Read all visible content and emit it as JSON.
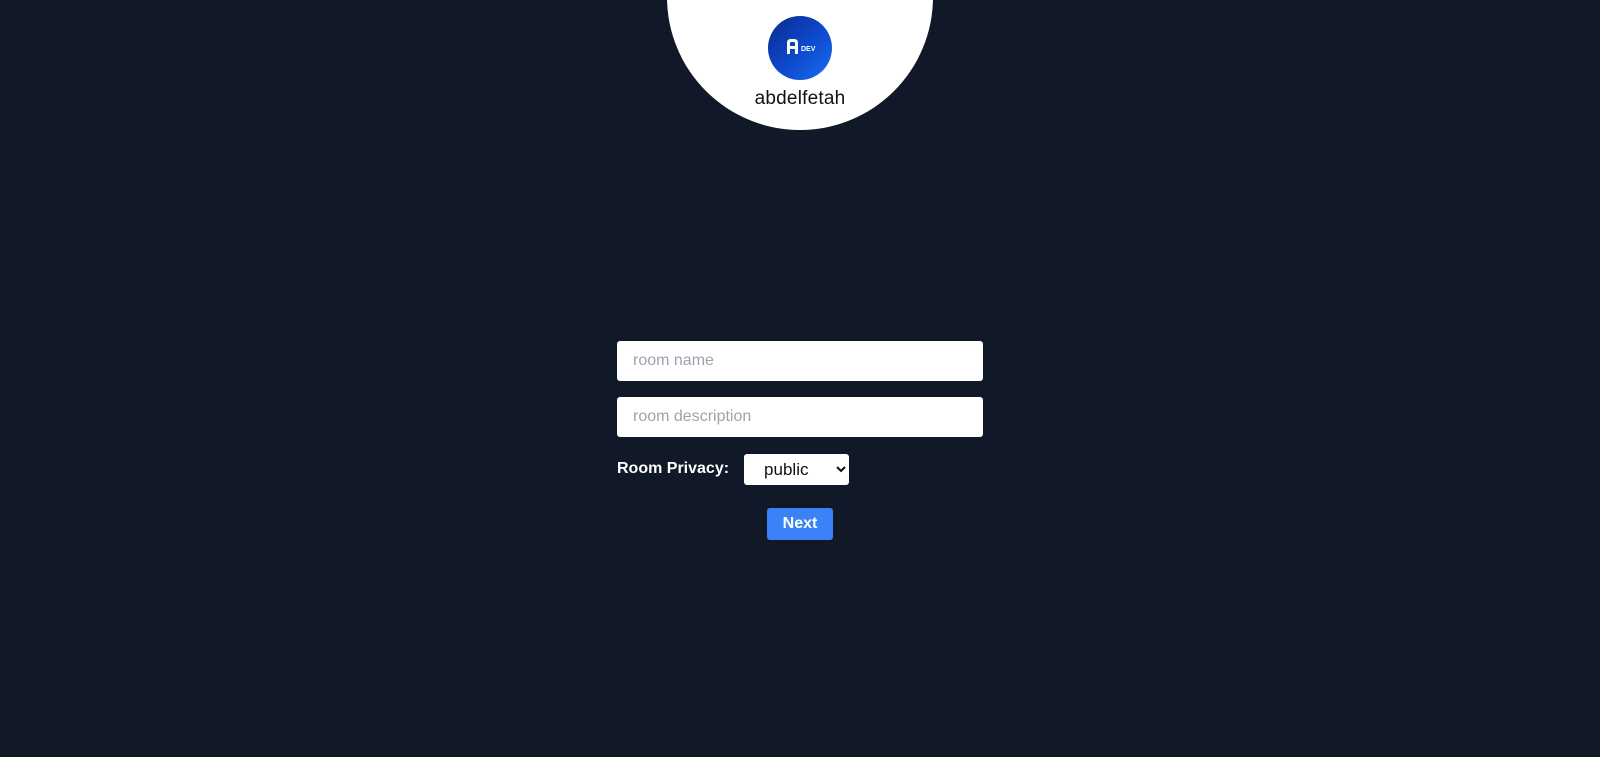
{
  "profile": {
    "username": "abdelfetah",
    "avatar_logo_text": "A DEV",
    "avatar_icon": "logo-icon"
  },
  "form": {
    "room_name": {
      "value": "",
      "placeholder": "room name"
    },
    "room_description": {
      "value": "",
      "placeholder": "room description"
    },
    "privacy": {
      "label": "Room Privacy:",
      "selected": "public",
      "options": [
        "public"
      ]
    },
    "next_label": "Next"
  },
  "colors": {
    "background": "#111827",
    "accent": "#3b82f6",
    "card": "#ffffff"
  }
}
